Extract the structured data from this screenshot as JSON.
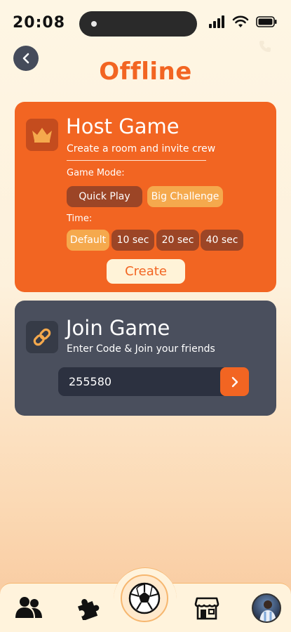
{
  "status_bar": {
    "time": "20:08"
  },
  "header": {
    "title": "Offline"
  },
  "host_card": {
    "title": "Host Game",
    "subtitle": "Create a room and invite crew",
    "mode_label": "Game Mode:",
    "modes": [
      {
        "label": "Quick Play",
        "selected": false
      },
      {
        "label": "Big Challenge",
        "selected": true
      }
    ],
    "time_label": "Time:",
    "times": [
      {
        "label": "Default",
        "selected": true
      },
      {
        "label": "10 sec",
        "selected": false
      },
      {
        "label": "20 sec",
        "selected": false
      },
      {
        "label": "40 sec",
        "selected": false
      }
    ],
    "create_label": "Create"
  },
  "join_card": {
    "title": "Join Game",
    "subtitle": "Enter Code & Join your friends",
    "code_value": "255580"
  },
  "bottom_nav": {
    "items": [
      "people-icon",
      "puzzle-icon",
      "soccer-ball-icon",
      "store-icon",
      "avatar"
    ]
  },
  "colors": {
    "accent": "#f26522",
    "dark_card": "#4a4f5d",
    "chip_selected": "#f5a94d",
    "chip_unselected": "#9c4526"
  }
}
